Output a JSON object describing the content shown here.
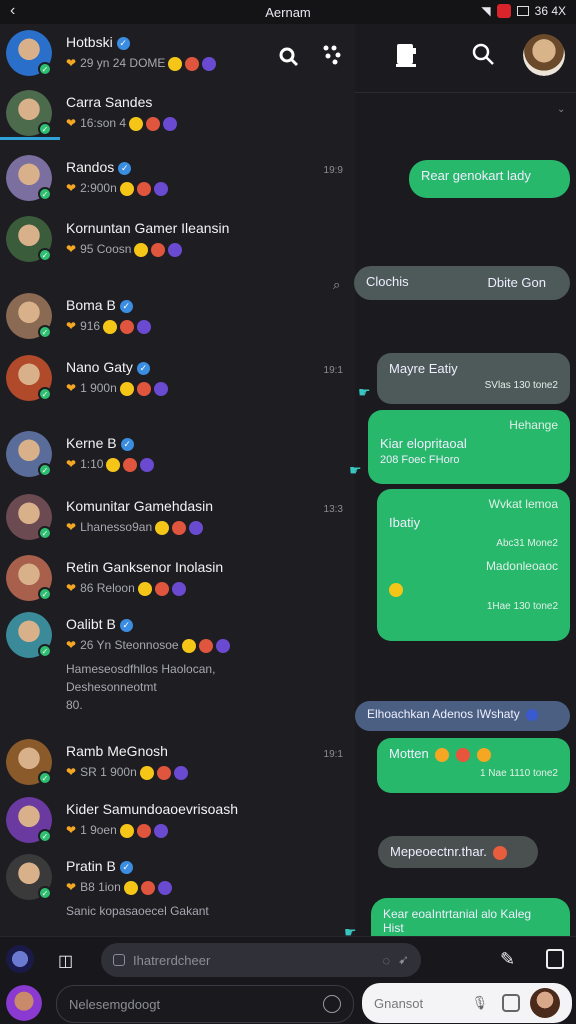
{
  "status": {
    "title": "Aernam",
    "right_text": "36 4X"
  },
  "contacts": [
    {
      "name": "Hotbski",
      "sub": "29 yn 24 DOME",
      "verified": true,
      "color": "#2a6fc9",
      "time": ""
    },
    {
      "name": "Carra Sandes",
      "sub": "16:son 4",
      "verified": false,
      "color": "#4c6a4c",
      "time": ""
    },
    {
      "name": "Randos",
      "sub": "2:900n",
      "verified": true,
      "color": "#7b6fa0",
      "time": "19:9"
    },
    {
      "name": "Kornuntan Gamer Ileansin",
      "sub": "95 Coosn",
      "verified": false,
      "color": "#3a5c3a",
      "time": ""
    },
    {
      "name": "Boma B",
      "sub": "916",
      "verified": true,
      "color": "#8a6a52",
      "time": ""
    },
    {
      "name": "Nano Gaty",
      "sub": "1 900n",
      "verified": true,
      "color": "#b04a2a",
      "time": "19:1"
    },
    {
      "name": "Kerne B",
      "sub": "1:10",
      "verified": true,
      "color": "#5a6d9a",
      "time": ""
    },
    {
      "name": "Komunitar Gamehdasin",
      "sub": "Lhanesso9an",
      "verified": false,
      "color": "#6b4a52",
      "time": "13:3"
    },
    {
      "name": "Retin Ganksenor Inolasin",
      "sub": "86 Reloon",
      "verified": false,
      "color": "#a8604c",
      "time": ""
    },
    {
      "name": "Oalibt B",
      "sub": "26 Yn Steonnosoe",
      "verified": true,
      "color": "#3a8a9a",
      "time": "",
      "extra1": "Hameseosdfhllos Haolocan,",
      "extra2": "Deshesonneotmt",
      "extra3": "80."
    },
    {
      "name": "Ramb MeGnosh",
      "sub": "SR 1 900n",
      "verified": false,
      "color": "#8a5a2a",
      "time": "19:1"
    },
    {
      "name": "Kider Samundoaoevrisoash",
      "sub": "1 9oen",
      "verified": false,
      "color": "#6a3aa0",
      "time": ""
    },
    {
      "name": "Pratin B",
      "sub": "B8 1ion",
      "verified": true,
      "color": "#3a3a3a",
      "time": "",
      "extra1": "Sanic kopasaoecel Gakant"
    }
  ],
  "messages": [
    {
      "kind": "green",
      "text": "Rear genokart lady",
      "meta": ""
    },
    {
      "kind": "grey",
      "text": "Clochis",
      "meta": "Dbite Gon"
    },
    {
      "kind": "grey",
      "text": "Mayre Eatiy",
      "meta": "SVlas 130 tone2"
    },
    {
      "kind": "green",
      "text": "Kiar elopritaoal",
      "meta": "Hehange",
      "meta2": "208 Foec FHoro"
    },
    {
      "kind": "green",
      "text": "Wvkat lemoa",
      "meta": "Abc31 Mone2",
      "text2": "Ibatiy"
    },
    {
      "kind": "green",
      "text": "Madonleoaoc",
      "meta": "1Hae 130 tone2"
    },
    {
      "kind": "blue",
      "text": "Elhoachkan Adenos IWshaty",
      "meta": ""
    },
    {
      "kind": "green",
      "text": "Motten",
      "meta": "1 Nae 1110 tone2"
    },
    {
      "kind": "grey",
      "text": "Mepeoectnr.thar.",
      "meta": ""
    },
    {
      "kind": "green",
      "text": "Kear eoaIntrtanial alo Kaleg",
      "meta": "Hist"
    }
  ],
  "composer": {
    "top_placeholder": "Ihatrerdcheer",
    "bottom_left_placeholder": "Nelesemgdoogt",
    "bottom_right_placeholder": "Gnansot"
  }
}
